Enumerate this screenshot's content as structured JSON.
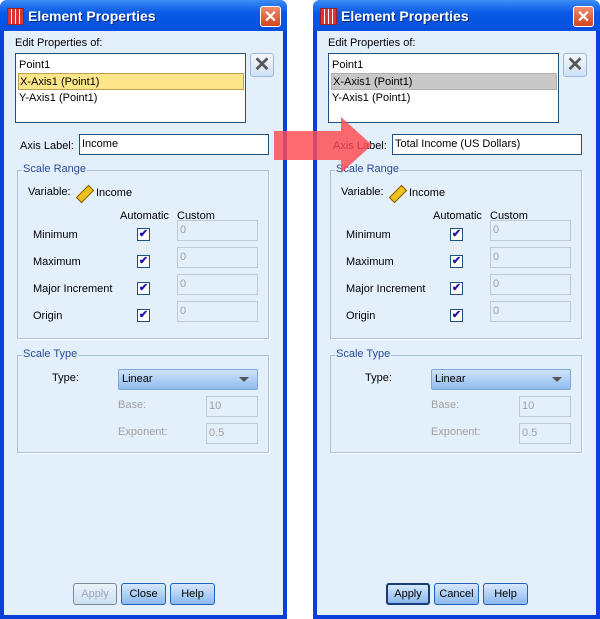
{
  "dialogs": [
    {
      "title": "Element Properties",
      "edit_properties_label": "Edit Properties of:",
      "list_items": [
        "Point1",
        "X-Axis1 (Point1)",
        "Y-Axis1 (Point1)"
      ],
      "selected_index": 1,
      "selection_style": "highlight-yellow",
      "axis_label_caption": "Axis Label:",
      "axis_label_value": "Income",
      "scale_range": {
        "legend": "Scale Range",
        "variable_label": "Variable:",
        "variable_value": "Income",
        "col_automatic": "Automatic",
        "col_custom": "Custom",
        "rows": [
          {
            "label": "Minimum",
            "automatic": true,
            "custom": "0"
          },
          {
            "label": "Maximum",
            "automatic": true,
            "custom": "0"
          },
          {
            "label": "Major Increment",
            "automatic": true,
            "custom": "0"
          },
          {
            "label": "Origin",
            "automatic": true,
            "custom": "0"
          }
        ]
      },
      "scale_type": {
        "legend": "Scale Type",
        "type_label": "Type:",
        "type_value": "Linear",
        "base_label": "Base:",
        "base_value": "10",
        "exponent_label": "Exponent:",
        "exponent_value": "0.5"
      },
      "buttons": [
        {
          "label": "Apply",
          "state": "disabled"
        },
        {
          "label": "Close",
          "state": "normal"
        },
        {
          "label": "Help",
          "state": "normal"
        }
      ]
    },
    {
      "title": "Element Properties",
      "edit_properties_label": "Edit Properties of:",
      "list_items": [
        "Point1",
        "X-Axis1 (Point1)",
        "Y-Axis1 (Point1)"
      ],
      "selected_index": 1,
      "selection_style": "highlight-gray",
      "axis_label_caption": "Axis Label:",
      "axis_label_value": "Total Income (US Dollars)",
      "scale_range": {
        "legend": "Scale Range",
        "variable_label": "Variable:",
        "variable_value": "Income",
        "col_automatic": "Automatic",
        "col_custom": "Custom",
        "rows": [
          {
            "label": "Minimum",
            "automatic": true,
            "custom": "0"
          },
          {
            "label": "Maximum",
            "automatic": true,
            "custom": "0"
          },
          {
            "label": "Major Increment",
            "automatic": true,
            "custom": "0"
          },
          {
            "label": "Origin",
            "automatic": true,
            "custom": "0"
          }
        ]
      },
      "scale_type": {
        "legend": "Scale Type",
        "type_label": "Type:",
        "type_value": "Linear",
        "base_label": "Base:",
        "base_value": "10",
        "exponent_label": "Exponent:",
        "exponent_value": "0.5"
      },
      "buttons": [
        {
          "label": "Apply",
          "state": "default"
        },
        {
          "label": "Cancel",
          "state": "normal"
        },
        {
          "label": "Help",
          "state": "normal"
        }
      ]
    }
  ],
  "arrow_color": "#ff4a4f"
}
